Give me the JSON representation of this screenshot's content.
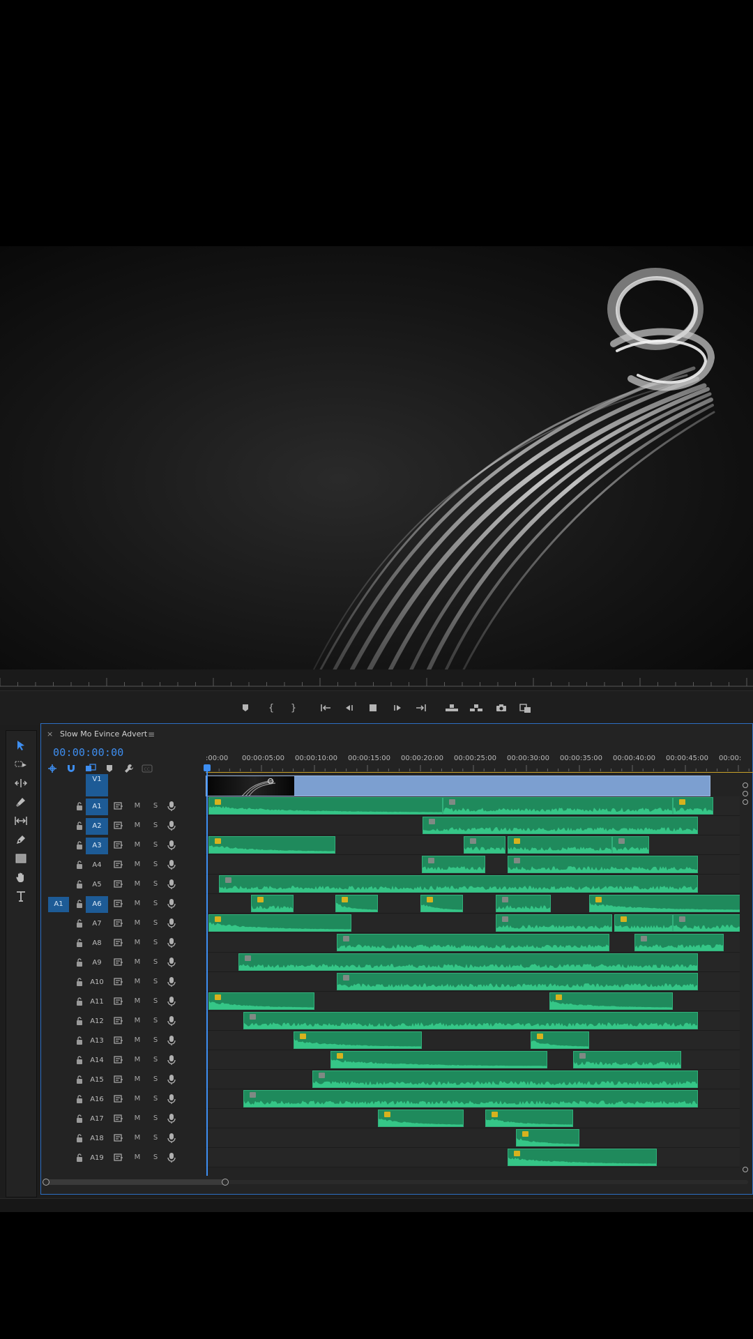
{
  "sequence": {
    "tab_close": "×",
    "name": "Slow Mo Evince Advert",
    "menu": "≡",
    "timecode": "00:00:00:00"
  },
  "ruler": {
    "labels": [
      ":00:00",
      "00:00:05:00",
      "00:00:10:00",
      "00:00:15:00",
      "00:00:20:00",
      "00:00:25:00",
      "00:00:30:00",
      "00:00:35:00",
      "00:00:40:00",
      "00:00:45:00",
      "00:00:"
    ]
  },
  "tracks": {
    "video": {
      "name": "V1"
    },
    "audio": [
      {
        "name": "A1",
        "targeted": true,
        "source": ""
      },
      {
        "name": "A2",
        "targeted": true,
        "source": ""
      },
      {
        "name": "A3",
        "targeted": true,
        "source": ""
      },
      {
        "name": "A4",
        "targeted": false,
        "source": ""
      },
      {
        "name": "A5",
        "targeted": false,
        "source": ""
      },
      {
        "name": "A6",
        "targeted": true,
        "source": "A1"
      },
      {
        "name": "A7",
        "targeted": false,
        "source": ""
      },
      {
        "name": "A8",
        "targeted": false,
        "source": ""
      },
      {
        "name": "A9",
        "targeted": false,
        "source": ""
      },
      {
        "name": "A10",
        "targeted": false,
        "source": ""
      },
      {
        "name": "A11",
        "targeted": false,
        "source": ""
      },
      {
        "name": "A12",
        "targeted": false,
        "source": ""
      },
      {
        "name": "A13",
        "targeted": false,
        "source": ""
      },
      {
        "name": "A14",
        "targeted": false,
        "source": ""
      },
      {
        "name": "A15",
        "targeted": false,
        "source": ""
      },
      {
        "name": "A16",
        "targeted": false,
        "source": ""
      },
      {
        "name": "A17",
        "targeted": false,
        "source": ""
      },
      {
        "name": "A18",
        "targeted": false,
        "source": ""
      },
      {
        "name": "A19",
        "targeted": false,
        "source": ""
      }
    ],
    "mute_label": "M",
    "solo_label": "S"
  },
  "clips": {
    "A1": [
      [
        0,
        22.1,
        "y"
      ],
      [
        22.1,
        43.8,
        "g"
      ],
      [
        43.8,
        47.6,
        "y"
      ]
    ],
    "A2": [
      [
        20.2,
        46.2,
        "g"
      ]
    ],
    "A3": [
      [
        0,
        12,
        "y"
      ],
      [
        24.1,
        28,
        "g"
      ],
      [
        28.2,
        38.1,
        "y"
      ],
      [
        38.1,
        41.6,
        "g"
      ]
    ],
    "A4": [
      [
        20.1,
        26.1,
        "g"
      ],
      [
        28.2,
        46.2,
        "g"
      ]
    ],
    "A5": [
      [
        1,
        46.2,
        "g"
      ]
    ],
    "A6": [
      [
        4,
        8,
        "y"
      ],
      [
        12,
        16,
        "y"
      ],
      [
        20,
        24,
        "y"
      ],
      [
        27.1,
        32.3,
        "g"
      ],
      [
        35.9,
        50.5,
        "y"
      ]
    ],
    "A7": [
      [
        0,
        13.5,
        "y"
      ],
      [
        27.1,
        38.1,
        "g"
      ],
      [
        38.3,
        43.8,
        "y"
      ],
      [
        43.8,
        50.5,
        "g"
      ]
    ],
    "A8": [
      [
        12.1,
        37.8,
        "g"
      ],
      [
        40.2,
        48.6,
        "g"
      ]
    ],
    "A9": [
      [
        2.8,
        46.2,
        "g"
      ]
    ],
    "A10": [
      [
        12.1,
        46.2,
        "g"
      ]
    ],
    "A11": [
      [
        0,
        10,
        "y"
      ],
      [
        32.2,
        43.8,
        "y"
      ]
    ],
    "A12": [
      [
        3.3,
        46.2,
        "g"
      ]
    ],
    "A13": [
      [
        8,
        20.1,
        "y"
      ],
      [
        30.4,
        35.9,
        "y"
      ]
    ],
    "A14": [
      [
        11.5,
        32,
        "y"
      ],
      [
        34.4,
        44.6,
        "g"
      ]
    ],
    "A15": [
      [
        9.8,
        46.2,
        "g"
      ]
    ],
    "A16": [
      [
        3.3,
        46.2,
        "g"
      ]
    ],
    "A17": [
      [
        16,
        24.1,
        "y"
      ],
      [
        26.1,
        34.4,
        "y"
      ]
    ],
    "A18": [
      [
        29,
        35,
        "y"
      ]
    ],
    "A19": [
      [
        28.2,
        42.3,
        "y"
      ]
    ]
  },
  "video_clip": {
    "end_seconds": 47.6
  },
  "colors": {
    "accent": "#3e8ef0",
    "audio_clip": "#1f8a5c",
    "audio_wave": "#39d08e",
    "video_clip": "#7c9fd0",
    "fx_badge": "#d7b21e"
  },
  "icons": {
    "tools": [
      "selection-tool-icon",
      "track-select-tool-icon",
      "ripple-edit-tool-icon",
      "razor-tool-icon",
      "slip-tool-icon",
      "pen-tool-icon",
      "rectangle-tool-icon",
      "hand-tool-icon",
      "type-tool-icon"
    ],
    "transport": [
      "add-marker-icon",
      "mark-in-icon",
      "mark-out-icon",
      "go-to-in-icon",
      "step-back-icon",
      "stop-icon",
      "step-forward-icon",
      "go-to-out-icon",
      "lift-icon",
      "extract-icon",
      "export-frame-icon",
      "compare-view-icon"
    ]
  }
}
